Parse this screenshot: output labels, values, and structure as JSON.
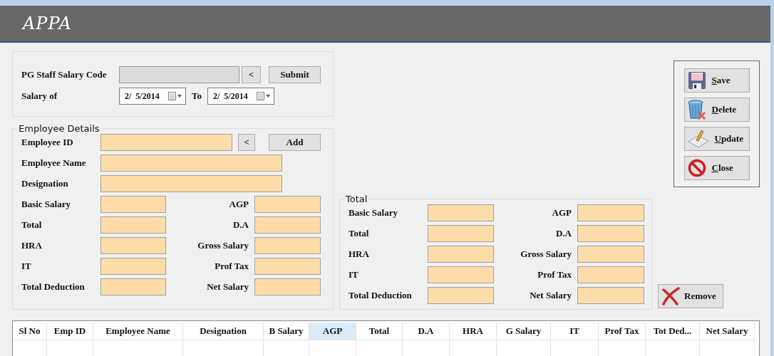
{
  "header": {
    "title": "APPA"
  },
  "salary_code": {
    "label": "PG Staff Salary Code",
    "lookup_button": "<",
    "submit_button": "Submit"
  },
  "date_range": {
    "label": "Salary of",
    "from": "2/  5/2014",
    "to_label": "To",
    "to": "2/  5/2014"
  },
  "employee_details": {
    "title": "Employee Details",
    "id_field": {
      "label": "Employee ID",
      "lookup_button": "<",
      "add_button": "Add"
    },
    "text_fields": [
      {
        "label": "Employee Name"
      },
      {
        "label": "Designation"
      }
    ],
    "pay_fields": [
      {
        "left": "Basic Salary",
        "right": "AGP"
      },
      {
        "left": "Total",
        "right": "D.A"
      },
      {
        "left": "HRA",
        "right": "Gross Salary"
      },
      {
        "left": "IT",
        "right": "Prof Tax"
      },
      {
        "left": "Total Deduction",
        "right": "Net Salary"
      }
    ]
  },
  "total": {
    "title": "Total",
    "pay_fields": [
      {
        "left": "Basic Salary",
        "right": "AGP"
      },
      {
        "left": "Total",
        "right": "D.A"
      },
      {
        "left": "HRA",
        "right": "Gross Salary"
      },
      {
        "left": "IT",
        "right": "Prof Tax"
      },
      {
        "left": "Total Deduction",
        "right": "Net Salary"
      }
    ]
  },
  "actions": [
    {
      "label": "Save",
      "kind": "save"
    },
    {
      "label": "Delete",
      "kind": "delete"
    },
    {
      "label": "Update",
      "kind": "update"
    },
    {
      "label": "Close",
      "kind": "close"
    }
  ],
  "remove_button": {
    "label": "Remove"
  },
  "grid": {
    "columns": [
      {
        "label": "Sl No",
        "selected": false
      },
      {
        "label": "Emp ID",
        "selected": false
      },
      {
        "label": "Employee Name",
        "selected": false
      },
      {
        "label": "Designation",
        "selected": false
      },
      {
        "label": "B Salary",
        "selected": false
      },
      {
        "label": "AGP",
        "selected": true
      },
      {
        "label": "Total",
        "selected": false
      },
      {
        "label": "D.A",
        "selected": false
      },
      {
        "label": "HRA",
        "selected": false
      },
      {
        "label": "G Salary",
        "selected": false
      },
      {
        "label": "IT",
        "selected": false
      },
      {
        "label": "Prof Tax",
        "selected": false
      },
      {
        "label": "Tot Ded...",
        "selected": false
      },
      {
        "label": "Net Salary",
        "selected": false
      }
    ]
  }
}
